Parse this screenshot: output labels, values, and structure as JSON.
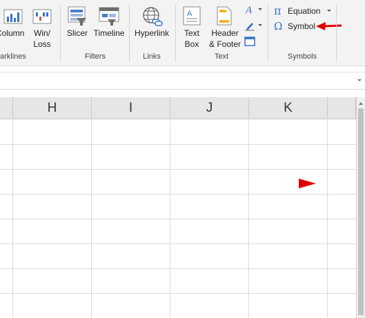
{
  "ribbon": {
    "sparklines": {
      "column_label": "Column",
      "winloss_label": "Win/\nLoss",
      "group_label": "arklines"
    },
    "filters": {
      "slicer_label": "Slicer",
      "timeline_label": "Timeline",
      "group_label": "Filters"
    },
    "links": {
      "hyperlink_label": "Hyperlink",
      "group_label": "Links"
    },
    "text": {
      "textbox_label": "Text\nBox",
      "header_footer_label": "Header\n& Footer",
      "group_label": "Text"
    },
    "symbols": {
      "equation_label": "Equation",
      "equation_icon": "π",
      "symbol_label": "Symbol",
      "symbol_icon": "Ω",
      "group_label": "Symbols"
    }
  },
  "sheet": {
    "columns": [
      "H",
      "I",
      "J",
      "K"
    ]
  },
  "annotations": {
    "arrow_color": "#e00000"
  }
}
